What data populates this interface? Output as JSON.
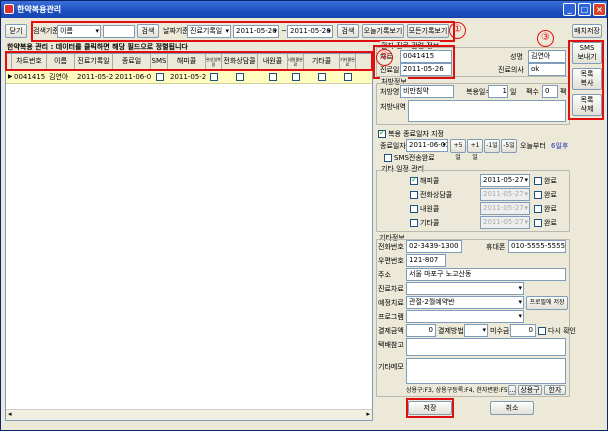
{
  "window": {
    "title": "한약복용관리"
  },
  "toolbar": {
    "close_label": "닫기",
    "search_by_label": "검색기준",
    "search_by_value": "이름",
    "search_input": "",
    "search_button": "검색",
    "date_by_label": "날짜기준",
    "date_by_value": "진료기록일",
    "date_from": "2011-05-20",
    "date_to": "2011-05-26",
    "search2_button": "검색",
    "today_button": "오늘기록보기",
    "all_button": "모든기록보기"
  },
  "notice": "한약복용 관리 : 데이터를 클릭하면 해당 필드으로 정렬됩니다",
  "grid": {
    "columns": [
      "차트번호",
      "이름",
      "진료기록일",
      "종료일",
      "SMS",
      "해피콜",
      "완성일복용",
      "전화상담콜",
      "내원콜",
      "내원콜완료",
      "기타콜",
      "기타콜완료"
    ],
    "rows": [
      {
        "chart_no": "0041415",
        "name": "김연아",
        "record_date": "2011-05-26",
        "end_date": "2011-06-01",
        "sms": false,
        "happy_date": "2011-05-27",
        "c1": false,
        "c2": false,
        "c3": false,
        "c4": false,
        "c5": false
      }
    ]
  },
  "right": {
    "patient_group": "환자·진료·관련 정보",
    "chart_label": "차트",
    "chart_value": "0041415",
    "name_label": "성명",
    "name_value": "김연아",
    "date_label": "진료일",
    "date_value": "2011-05-26",
    "doctor_label": "진료의사",
    "doctor_value": "ok",
    "rx_group": "처방정보",
    "rx_name_label": "처방명",
    "rx_name_value": "비만침약",
    "days_label": "복용일수",
    "days_value": "1",
    "days_unit": "일",
    "packs_label": "팩수",
    "packs_value": "0",
    "packs_unit": "팩",
    "rx_detail_label": "처방내역",
    "end_check_label": "복용 종료일자 지정",
    "end_date_label": "종료일자",
    "end_date_value": "2011-06-01",
    "plus5": "+5일",
    "plus1": "+1일",
    "minus1": "-1일",
    "minus5": "-5일",
    "today_label": "오늘부터",
    "days_count": "6일후",
    "sms_done_label": "SMS전송완료",
    "other_group": "기타 일정 관리",
    "happy_label": "해피콜",
    "happy_date": "2011-05-27",
    "done_label": "완료",
    "phone_label": "전화상담콜",
    "visit_label": "내원콜",
    "etc_label": "기타콜",
    "grey_date": "2011-05-27",
    "info_group": "기타정보",
    "phone_no_label": "전화번호",
    "phone_no_value": "02-3439-1300",
    "mobile_label": "휴대폰",
    "mobile_value": "010-5555-5555",
    "zip_label": "우편번호",
    "zip_value": "121-807",
    "addr_label": "주소",
    "addr_value": "서울 마포구 노고산동",
    "referral_label": "진료차료",
    "plan_label": "예정치료",
    "plan_value": "관절-2월예약반",
    "plan_button": "프로필에 저장",
    "program_label": "프로그램",
    "pay_label": "결제금액",
    "pay_value": "0",
    "method_label": "결제방법",
    "unpaid_label": "미수금",
    "unpaid_value": "0",
    "confirm_label": "다시 확인",
    "note1_label": "택배참고",
    "note2_label": "기타메모",
    "footer_hint": "상용구:F3, 상용구등록:F4, 한자변환:F5",
    "phrase_button": "상용구",
    "hanja_button": "한자",
    "save_button": "저장",
    "cancel_button": "취소"
  },
  "sidebar": {
    "printer_label": "배치저장",
    "sms_label": "SMS\n보내기",
    "copy_label": "목록\n복사",
    "delete_label": "목록\n삭제"
  },
  "markers": [
    "①",
    "②",
    "③"
  ]
}
